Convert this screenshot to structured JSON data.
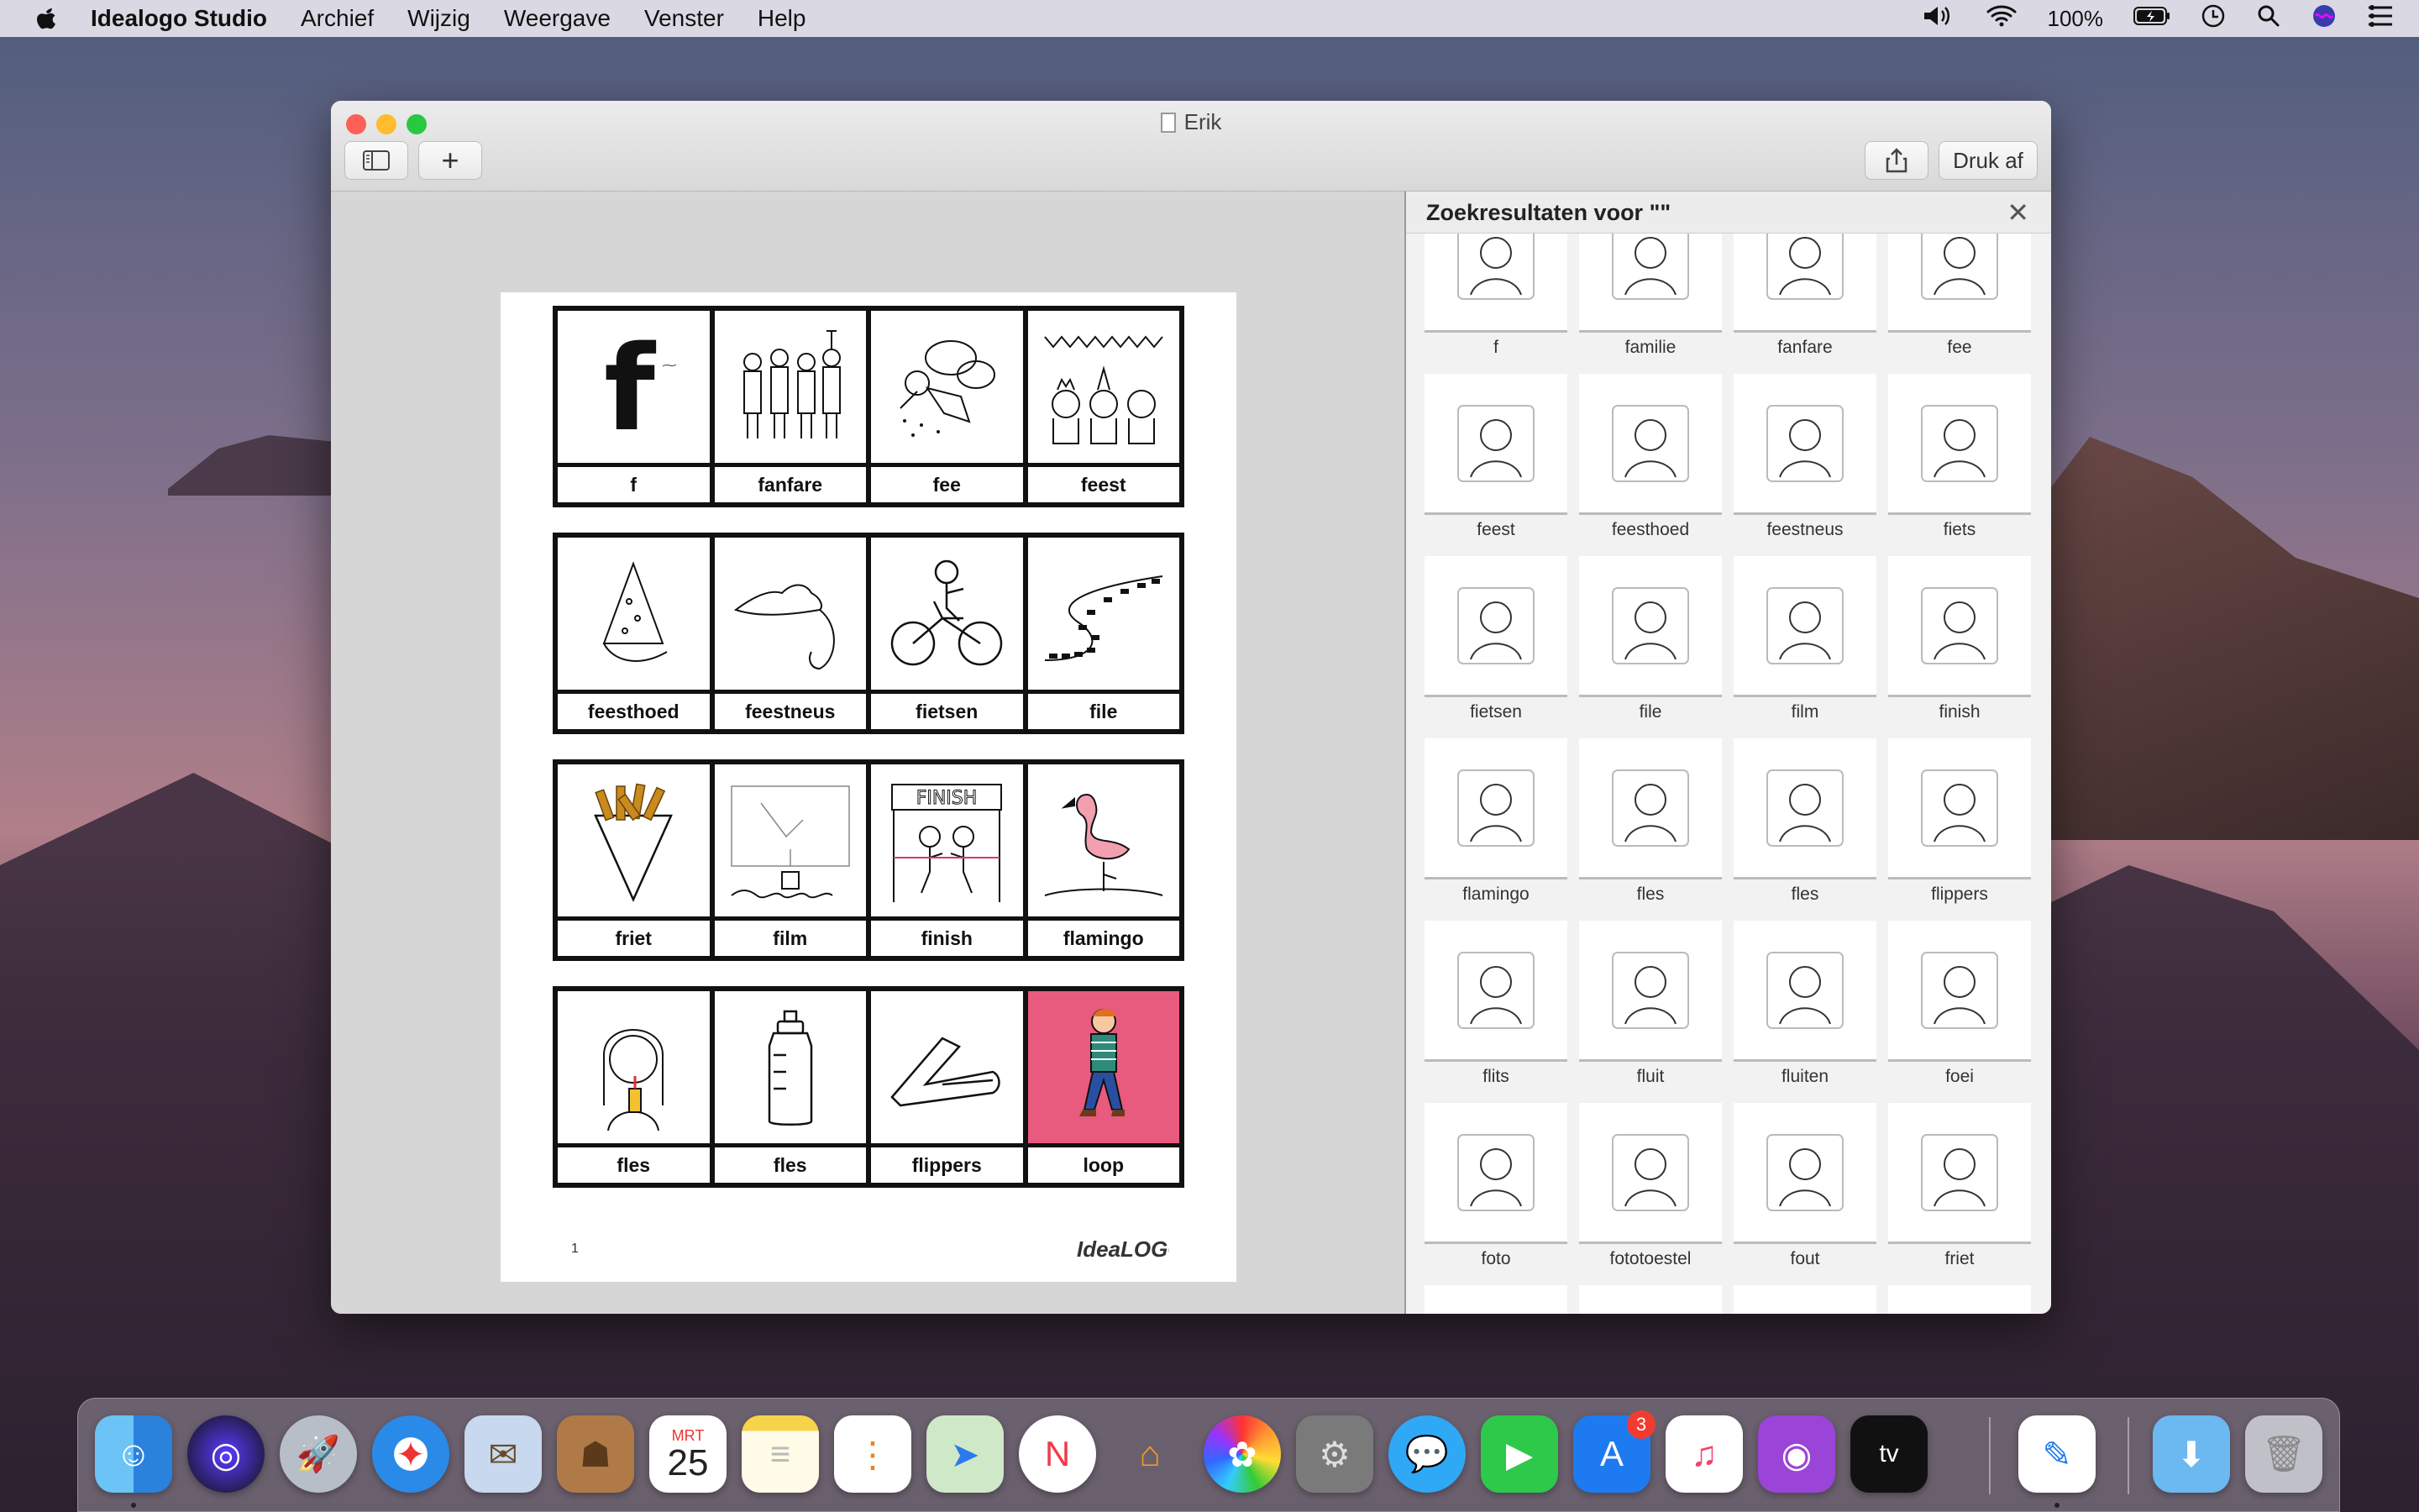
{
  "menubar": {
    "app_name": "Idealogo Studio",
    "menus": [
      "Archief",
      "Wijzig",
      "Weergave",
      "Venster",
      "Help"
    ],
    "battery": "100%"
  },
  "window": {
    "title": "Erik",
    "add_label": "+",
    "print_label": "Druk af"
  },
  "page": {
    "number": "1",
    "logo": "IdeaLOGO",
    "groups": [
      [
        "f",
        "fanfare",
        "fee",
        "feest"
      ],
      [
        "feesthoed",
        "feestneus",
        "fietsen",
        "file"
      ],
      [
        "friet",
        "film",
        "finish",
        "flamingo"
      ],
      [
        "fles",
        "fles",
        "flippers",
        "loop"
      ]
    ]
  },
  "panel": {
    "title": "Zoekresultaten voor \"\"",
    "close": "✕",
    "results": [
      "f",
      "familie",
      "fanfare",
      "fee",
      "feest",
      "feesthoed",
      "feestneus",
      "fiets",
      "fietsen",
      "file",
      "film",
      "finish",
      "flamingo",
      "fles",
      "fles",
      "flippers",
      "flits",
      "fluit",
      "fluiten",
      "foei",
      "foto",
      "fototoestel",
      "fout",
      "friet",
      "",
      "",
      "",
      ""
    ]
  },
  "dock": {
    "calendar_month": "MRT",
    "calendar_day": "25",
    "appstore_badge": "3",
    "tv_label": "tv"
  },
  "colors": {
    "card_border": "#111111",
    "loop_card": "#e85a7e"
  }
}
